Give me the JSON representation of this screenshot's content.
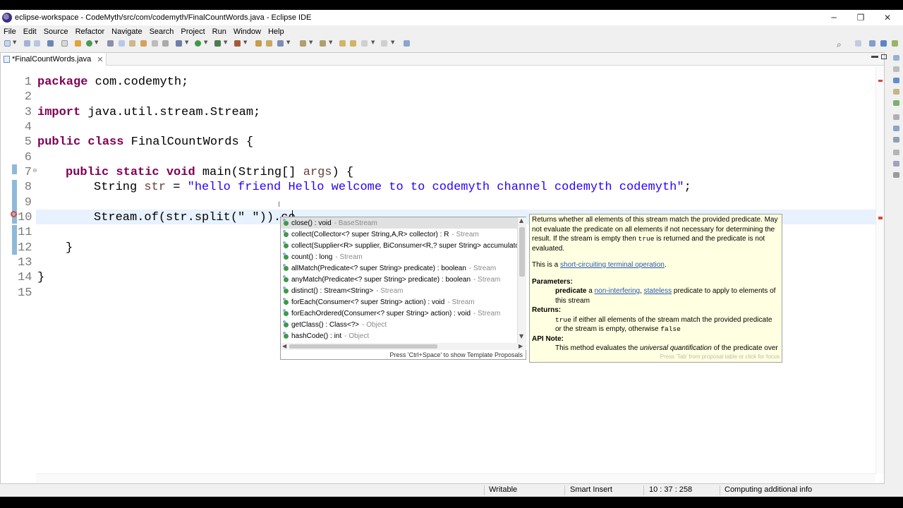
{
  "window": {
    "title": "eclipse-workspace - CodeMyth/src/com/codemyth/FinalCountWords.java - Eclipse IDE",
    "controls": {
      "minimize": "─",
      "restore": "❐",
      "close": "✕"
    }
  },
  "menubar": {
    "items": [
      "File",
      "Edit",
      "Source",
      "Refactor",
      "Navigate",
      "Search",
      "Project",
      "Run",
      "Window",
      "Help"
    ]
  },
  "toolbar": {
    "search_icon": "⌕"
  },
  "editor": {
    "tab_label": "*FinalCountWords.java",
    "tab_close": "✕",
    "current_line": 10
  },
  "code": {
    "line_numbers": [
      "1",
      "2",
      "3",
      "4",
      "5",
      "6",
      "7",
      "8",
      "9",
      "10",
      "11",
      "12",
      "13",
      "14",
      "15"
    ],
    "line1": {
      "kw": "package",
      "rest": " com.codemyth;"
    },
    "line3": {
      "kw": "import",
      "rest": " java.util.stream.Stream;"
    },
    "line5": {
      "kw1": "public",
      "kw2": "class",
      "rest": " FinalCountWords {"
    },
    "line7": {
      "kw1": "public",
      "kw2": "static",
      "kw3": "void",
      "rest": " main(String[] ",
      "var": "args",
      "tail": ") {"
    },
    "line8": {
      "pre": "String ",
      "var": "str",
      "mid": " = ",
      "str": "\"hello friend Hello welcome to to codemyth channel codemyth codemyth\"",
      "tail": ";"
    },
    "line10": {
      "text": "Stream.of(str.split(\" \")).co"
    },
    "line12": {
      "text": "}"
    },
    "line14": {
      "text": "}"
    }
  },
  "content_assist": {
    "proposals": [
      {
        "name": "close() : void",
        "type": " - BaseStream"
      },
      {
        "name": "collect(Collector<? super String,A,R> collector) : R",
        "type": " - Stream"
      },
      {
        "name": "collect(Supplier<R> supplier, BiConsumer<R,? super String> accumulato",
        "type": ""
      },
      {
        "name": "count() : long",
        "type": " - Stream"
      },
      {
        "name": "allMatch(Predicate<? super String> predicate) : boolean",
        "type": " - Stream"
      },
      {
        "name": "anyMatch(Predicate<? super String> predicate) : boolean",
        "type": " - Stream"
      },
      {
        "name": "distinct() : Stream<String>",
        "type": " - Stream"
      },
      {
        "name": "forEach(Consumer<? super String> action) : void",
        "type": " - Stream"
      },
      {
        "name": "forEachOrdered(Consumer<? super String> action) : void",
        "type": " - Stream"
      },
      {
        "name": "getClass() : Class<?>",
        "type": " - Object"
      },
      {
        "name": "hashCode() : int",
        "type": " - Object"
      }
    ],
    "footer": "Press 'Ctrl+Space' to show Template Proposals"
  },
  "javadoc": {
    "p1": "Returns whether all elements of this stream match the provided predicate. May not evaluate the predicate on all elements if not necessary for determining the result. If the stream is empty then ",
    "p1_code": "true",
    "p1_tail": " is returned and the predicate is not evaluated.",
    "p2_pre": "This is a ",
    "p2_link": "short-circuiting terminal operation",
    "p2_tail": ".",
    "params_h": "Parameters:",
    "param_name": "predicate",
    "param_pre": " a ",
    "param_link1": "non-interfering",
    "param_sep": ", ",
    "param_link2": "stateless",
    "param_tail": " predicate to apply to elements of this stream",
    "returns_h": "Returns:",
    "ret_code1": "true",
    "ret_text": " if either all elements of the stream match the provided predicate or the stream is empty, otherwise ",
    "ret_code2": "false",
    "api_h": "API Note:",
    "api_pre": "This method evaluates the ",
    "api_em": "universal quantification",
    "api_tail": " of the predicate over",
    "footer": "Press 'Tab' from proposal table or click for focus"
  },
  "statusbar": {
    "writable": "Writable",
    "insert_mode": "Smart Insert",
    "position": "10 : 37 : 258",
    "progress": "Computing additional info"
  }
}
